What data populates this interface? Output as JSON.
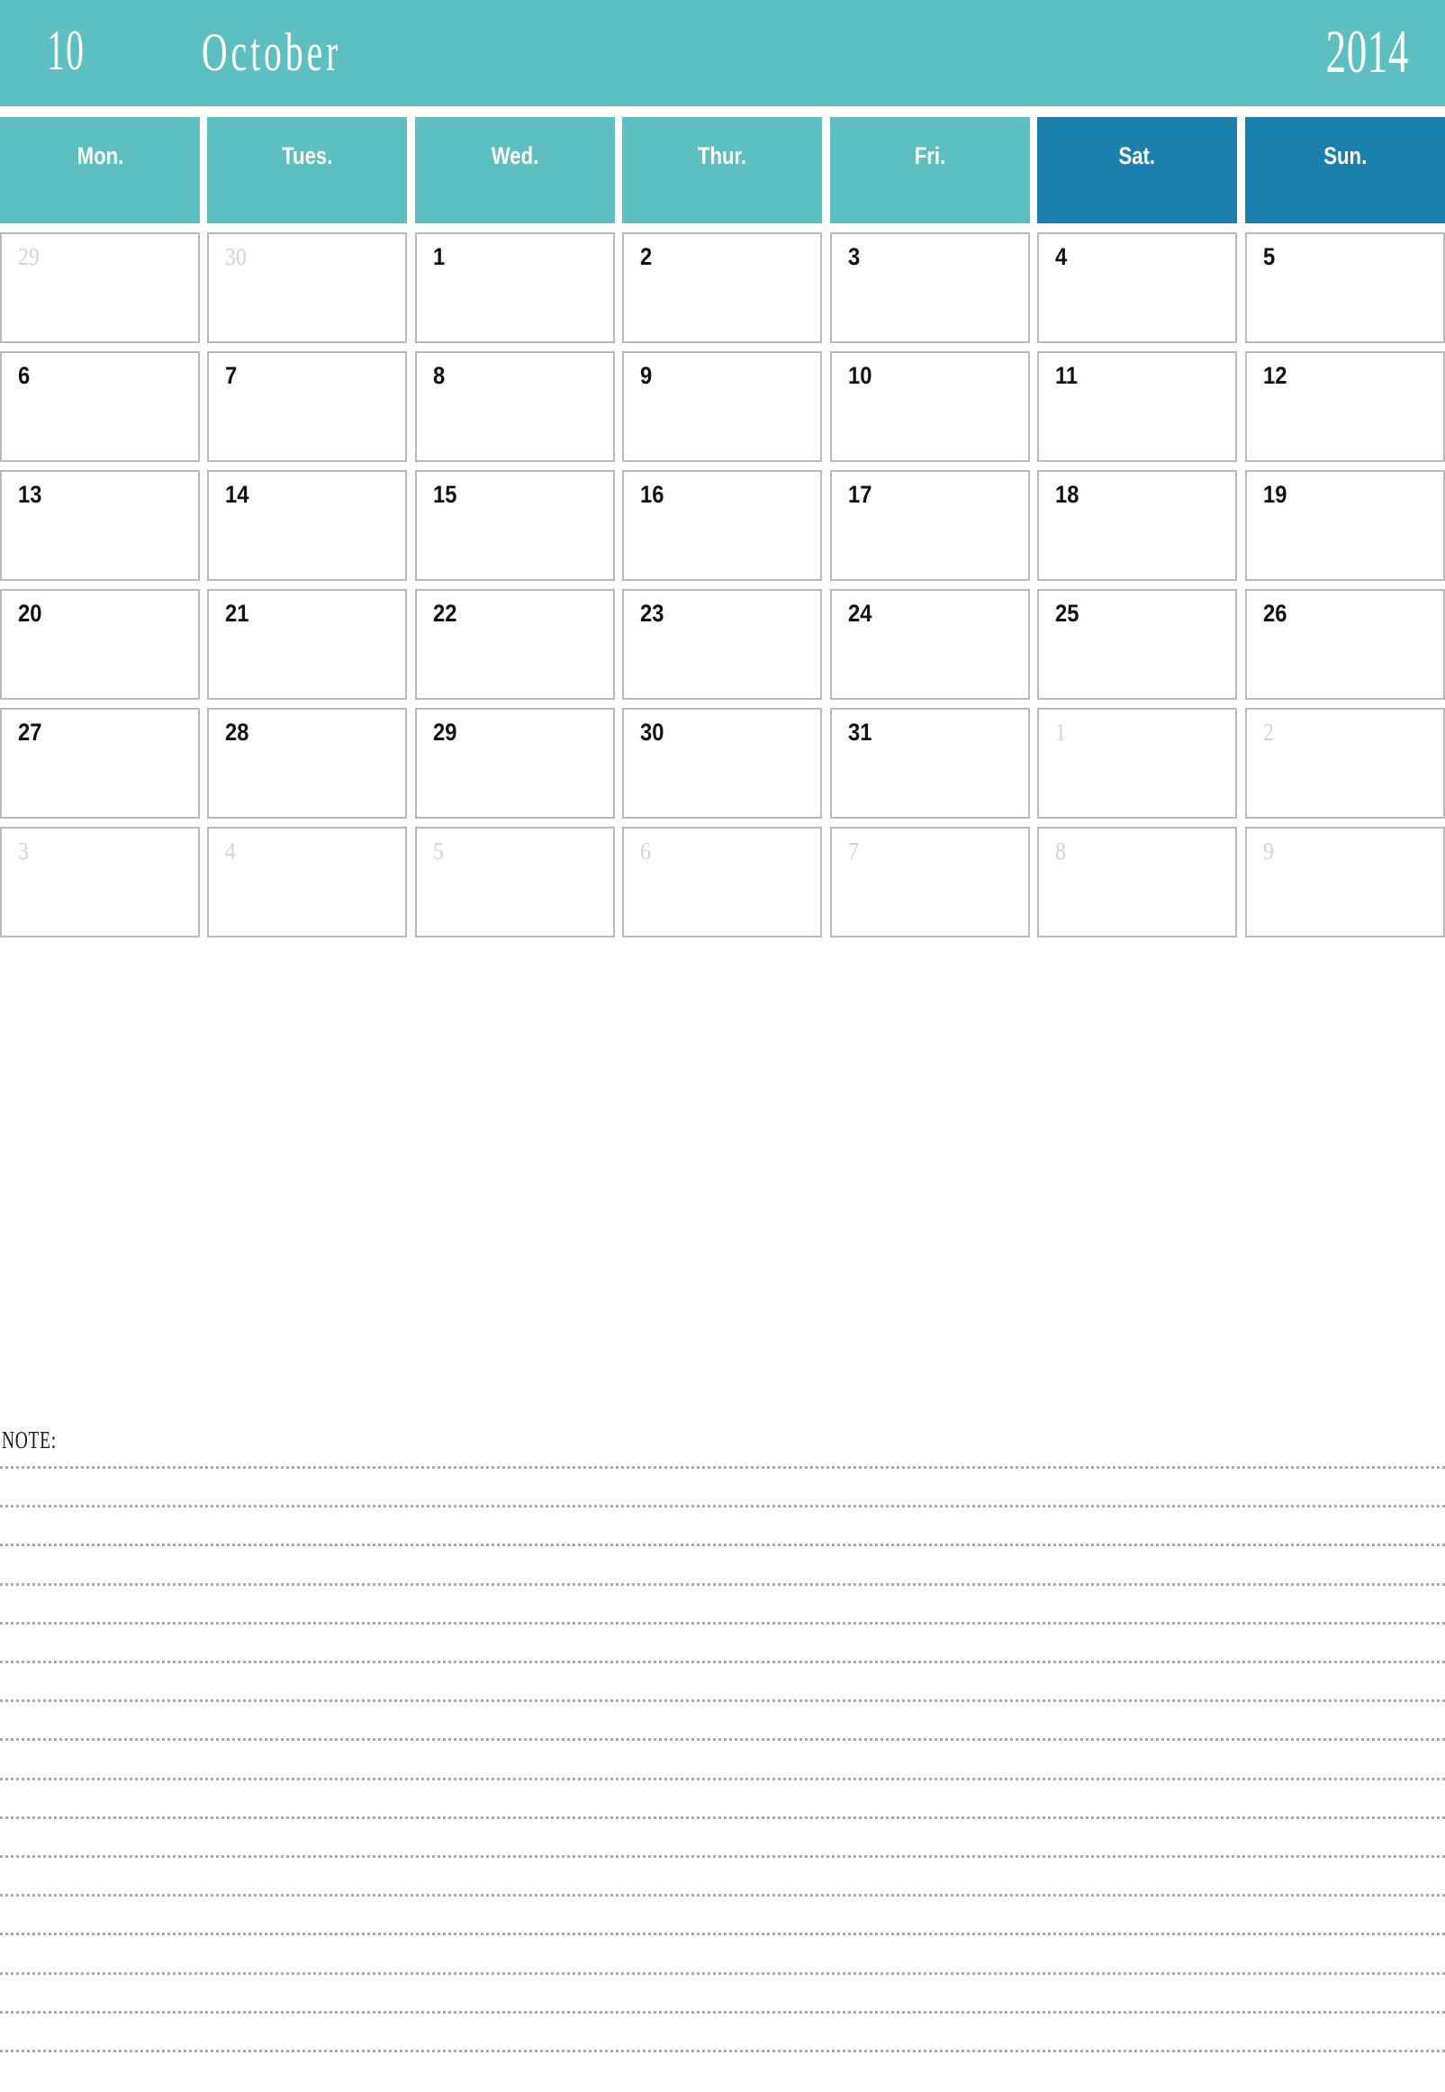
{
  "header": {
    "month_number": "10",
    "month_name": "October",
    "year": "2014",
    "background_color": "#5ebfc0",
    "text_color": "#ffffff"
  },
  "weekdays": [
    {
      "label": "Mon.",
      "type": "weekday",
      "color": "#5ebfc0"
    },
    {
      "label": "Tues.",
      "type": "weekday",
      "color": "#5ebfc0"
    },
    {
      "label": "Wed.",
      "type": "weekday",
      "color": "#5ebfc0"
    },
    {
      "label": "Thur.",
      "type": "weekday",
      "color": "#5ebfc0"
    },
    {
      "label": "Fri.",
      "type": "weekday",
      "color": "#5ebfc0"
    },
    {
      "label": "Sat.",
      "type": "weekend",
      "color": "#1b81ac"
    },
    {
      "label": "Sun.",
      "type": "weekend",
      "color": "#1b81ac"
    }
  ],
  "grid": {
    "cell_border_color": "#b9b9b9",
    "current_month_color": "#111111",
    "other_month_color": "#d3d3d3",
    "weeks": [
      [
        {
          "n": "29",
          "m": "prev"
        },
        {
          "n": "30",
          "m": "prev"
        },
        {
          "n": "1",
          "m": "cur"
        },
        {
          "n": "2",
          "m": "cur"
        },
        {
          "n": "3",
          "m": "cur"
        },
        {
          "n": "4",
          "m": "cur"
        },
        {
          "n": "5",
          "m": "cur"
        }
      ],
      [
        {
          "n": "6",
          "m": "cur"
        },
        {
          "n": "7",
          "m": "cur"
        },
        {
          "n": "8",
          "m": "cur"
        },
        {
          "n": "9",
          "m": "cur"
        },
        {
          "n": "10",
          "m": "cur"
        },
        {
          "n": "11",
          "m": "cur"
        },
        {
          "n": "12",
          "m": "cur"
        }
      ],
      [
        {
          "n": "13",
          "m": "cur"
        },
        {
          "n": "14",
          "m": "cur"
        },
        {
          "n": "15",
          "m": "cur"
        },
        {
          "n": "16",
          "m": "cur"
        },
        {
          "n": "17",
          "m": "cur"
        },
        {
          "n": "18",
          "m": "cur"
        },
        {
          "n": "19",
          "m": "cur"
        }
      ],
      [
        {
          "n": "20",
          "m": "cur"
        },
        {
          "n": "21",
          "m": "cur"
        },
        {
          "n": "22",
          "m": "cur"
        },
        {
          "n": "23",
          "m": "cur"
        },
        {
          "n": "24",
          "m": "cur"
        },
        {
          "n": "25",
          "m": "cur"
        },
        {
          "n": "26",
          "m": "cur"
        }
      ],
      [
        {
          "n": "27",
          "m": "cur"
        },
        {
          "n": "28",
          "m": "cur"
        },
        {
          "n": "29",
          "m": "cur"
        },
        {
          "n": "30",
          "m": "cur"
        },
        {
          "n": "31",
          "m": "cur"
        },
        {
          "n": "1",
          "m": "next"
        },
        {
          "n": "2",
          "m": "next"
        }
      ],
      [
        {
          "n": "3",
          "m": "next"
        },
        {
          "n": "4",
          "m": "next"
        },
        {
          "n": "5",
          "m": "next"
        },
        {
          "n": "6",
          "m": "next"
        },
        {
          "n": "7",
          "m": "next"
        },
        {
          "n": "8",
          "m": "next"
        },
        {
          "n": "9",
          "m": "next"
        }
      ]
    ]
  },
  "note": {
    "label": "NOTE:",
    "line_count": 16,
    "line_color": "#a8a8a8"
  }
}
